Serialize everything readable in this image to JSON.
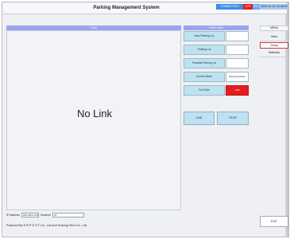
{
  "window": {
    "title": "Parking Management System"
  },
  "status": {
    "connection": "CONNECTION",
    "lpr": "LPR",
    "rs485": "RS-1",
    "datetime": "2020-01-21 15:40:49"
  },
  "camera": {
    "header": "CAM",
    "no_link_text": "No Link"
  },
  "footer": {
    "ip_label": "IP Address",
    "ip_value": "192.168.1.101",
    "channel_label": "Channel",
    "channel_value": "01",
    "powered_by": "Powered By S B P O S T Co., Ltd and Hosung Tech Co., Ltd"
  },
  "func": {
    "header": "FUNC-NEO",
    "rows": [
      {
        "label": "Now Parking Lot",
        "value": ""
      },
      {
        "label": "Parking Lot",
        "value": ""
      },
      {
        "label": "Possible Parking Lot",
        "value": ""
      },
      {
        "label": "Current Mode",
        "value": "Standing Mode"
      },
      {
        "label": "Full Gate",
        "value": "LPR"
      }
    ],
    "left_button": "LIVE",
    "right_button": "STOP"
  },
  "menu": {
    "header": "MENU",
    "items": [
      "Main",
      "Setup",
      "Statistics"
    ],
    "active": "Setup"
  },
  "exit_label": "EXIT",
  "colors": {
    "accent_blue": "#3a8ee6",
    "alert_red": "#e41e1e",
    "func_cell": "#bfe2f2",
    "header_blue": "#9aa4ee"
  }
}
